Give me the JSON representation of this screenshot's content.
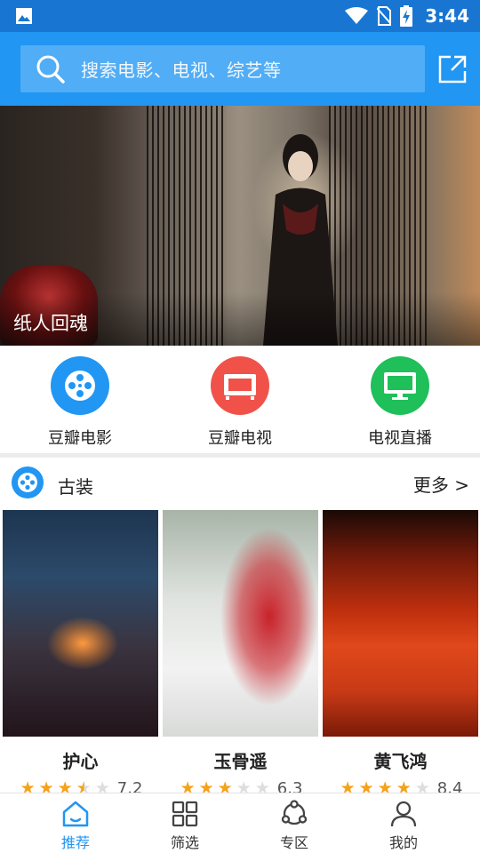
{
  "status_bar": {
    "time": "3:44"
  },
  "search": {
    "placeholder": "搜索电影、电视、综艺等"
  },
  "banner": {
    "caption": "纸人回魂"
  },
  "categories": [
    {
      "label": "豆瓣电影",
      "color": "#2196f3",
      "icon": "film-reel-icon"
    },
    {
      "label": "豆瓣电视",
      "color": "#f0524a",
      "icon": "tv-screen-icon"
    },
    {
      "label": "电视直播",
      "color": "#1fbf5a",
      "icon": "monitor-icon"
    }
  ],
  "section": {
    "title": "古装",
    "more": "更多 >"
  },
  "movies": [
    {
      "title": "护心",
      "stars": 3.5,
      "score": "7.2"
    },
    {
      "title": "玉骨遥",
      "stars": 3,
      "score": "6.3"
    },
    {
      "title": "黄飞鸿",
      "stars": 4,
      "score": "8.4"
    }
  ],
  "bottom_nav": [
    {
      "label": "推荐",
      "icon": "home-icon",
      "active": true
    },
    {
      "label": "筛选",
      "icon": "grid-icon",
      "active": false
    },
    {
      "label": "专区",
      "icon": "circles-icon",
      "active": false
    },
    {
      "label": "我的",
      "icon": "person-icon",
      "active": false
    }
  ],
  "colors": {
    "primary": "#2196f3",
    "status_bar": "#1876d2",
    "star": "#f4a21a"
  }
}
